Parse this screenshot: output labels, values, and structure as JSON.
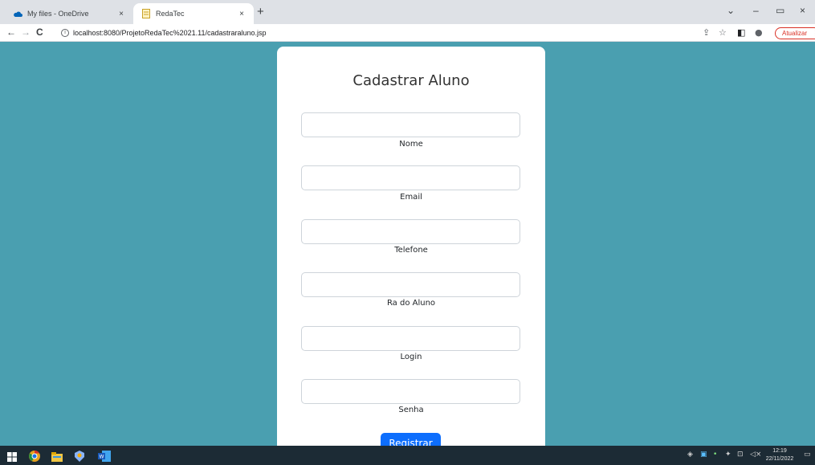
{
  "browser": {
    "tabs": [
      {
        "title": "My files - OneDrive",
        "close": "×"
      },
      {
        "title": "RedaTec",
        "close": "×"
      }
    ],
    "new_tab": "+",
    "window_controls": {
      "dropdown": "⌄",
      "minimize": "–",
      "restore": "▭",
      "close": "×"
    },
    "nav": {
      "back": "←",
      "forward": "→",
      "reload": "C"
    },
    "url": "localhost:8080/ProjetoRedaTec%2021.11/cadastraraluno.jsp",
    "update_label": "Atualizar",
    "update_more": "⋮"
  },
  "form": {
    "title": "Cadastrar Aluno",
    "fields": [
      {
        "label": "Nome",
        "value": ""
      },
      {
        "label": "Email",
        "value": ""
      },
      {
        "label": "Telefone",
        "value": ""
      },
      {
        "label": "Ra do Aluno",
        "value": ""
      },
      {
        "label": "Login",
        "value": ""
      },
      {
        "label": "Senha",
        "value": ""
      }
    ],
    "submit_label": "Registrar"
  },
  "taskbar": {
    "time": "12:19",
    "date": "22/11/2022"
  },
  "colors": {
    "page_bg": "#4a9fb0",
    "accent": "#0d6efd",
    "taskbar": "#1c2b35"
  }
}
